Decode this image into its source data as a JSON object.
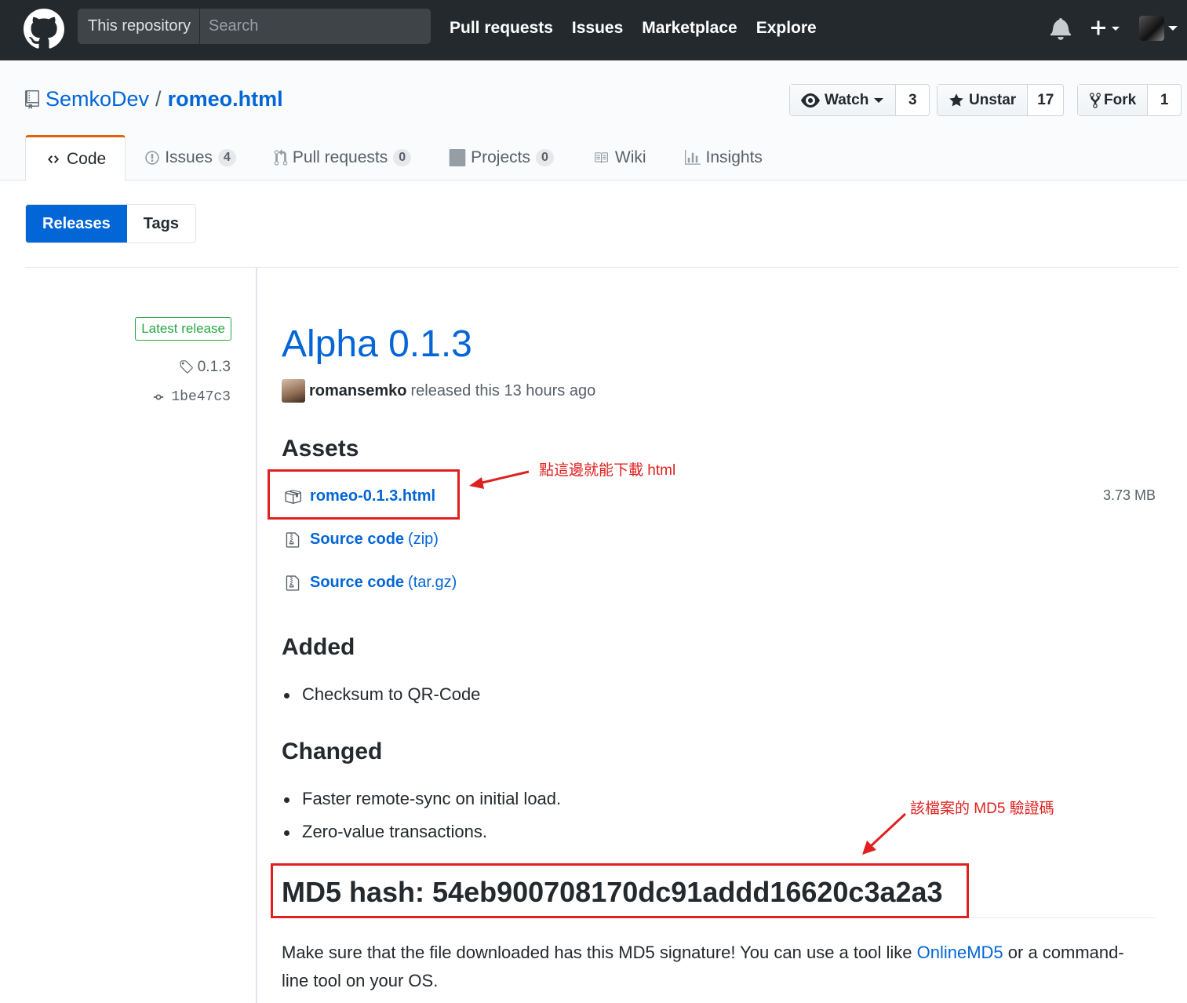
{
  "header": {
    "search_scope": "This repository",
    "search_placeholder": "Search",
    "nav": [
      "Pull requests",
      "Issues",
      "Marketplace",
      "Explore"
    ],
    "icons": [
      "github-logo-icon",
      "bell-icon",
      "plus-icon",
      "avatar"
    ]
  },
  "repo": {
    "owner": "SemkoDev",
    "separator": "/",
    "name": "romeo.html",
    "watch_label": "Watch",
    "watch_count": "3",
    "star_label": "Unstar",
    "star_count": "17",
    "fork_label": "Fork",
    "fork_count": "1"
  },
  "tabs": [
    {
      "label": "Code",
      "counter": null
    },
    {
      "label": "Issues",
      "counter": "4"
    },
    {
      "label": "Pull requests",
      "counter": "0"
    },
    {
      "label": "Projects",
      "counter": "0"
    },
    {
      "label": "Wiki",
      "counter": null
    },
    {
      "label": "Insights",
      "counter": null
    }
  ],
  "subnav": {
    "releases": "Releases",
    "tags": "Tags"
  },
  "release_meta": {
    "latest_label": "Latest release",
    "tag": "0.1.3",
    "commit": "1be47c3"
  },
  "release": {
    "title": "Alpha 0.1.3",
    "author": "romansemko",
    "released_text": "released this 13 hours ago",
    "assets_heading": "Assets",
    "assets": [
      {
        "name": "romeo-0.1.3.html",
        "ext": "",
        "size": "3.73 MB"
      },
      {
        "name": "Source code",
        "ext": "(zip)"
      },
      {
        "name": "Source code",
        "ext": "(tar.gz)"
      }
    ],
    "added_heading": "Added",
    "added": [
      "Checksum to QR-Code"
    ],
    "changed_heading": "Changed",
    "changed": [
      "Faster remote-sync on initial load.",
      "Zero-value transactions."
    ],
    "md5": "MD5 hash: 54eb900708170dc91addd16620c3a2a3",
    "para_before": "Make sure that the file downloaded has this MD5 signature! You can use a tool like ",
    "para_link": "OnlineMD5",
    "para_after": " or a command-line tool on your OS."
  },
  "annotations": {
    "download_note": "點這邊就能下載 html",
    "md5_note": "該檔案的 MD5 驗證碼",
    "color": "#e02020"
  }
}
